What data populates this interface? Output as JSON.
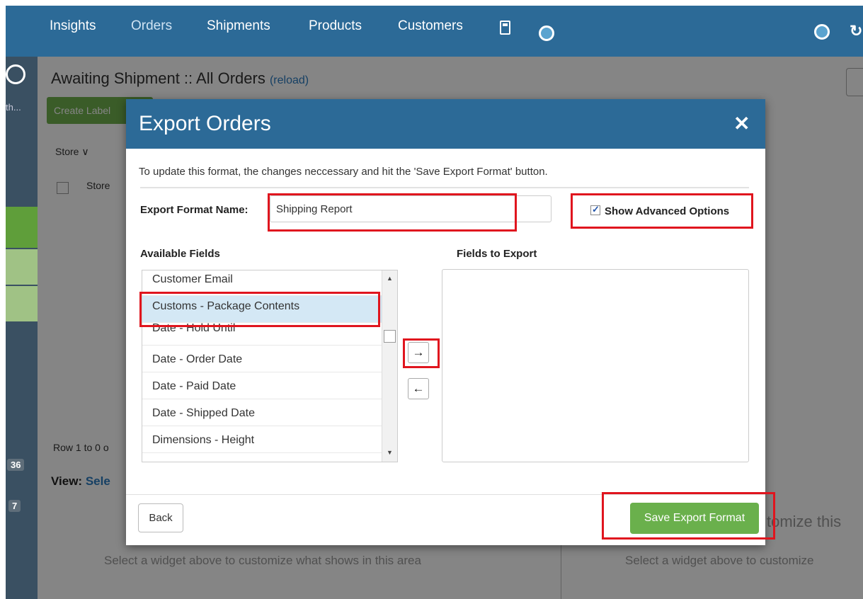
{
  "nav": {
    "items": [
      "Insights",
      "Orders",
      "Shipments",
      "Products",
      "Customers"
    ]
  },
  "page": {
    "title": "Awaiting Shipment :: All Orders",
    "reload": "(reload)",
    "create_label": "Create Label",
    "store_filter": "Store ∨",
    "store_col": "Store",
    "row_info": "Row 1 to 0 o",
    "view_label": "View:",
    "view_select": "Sele",
    "widget_hint_left": "Select a widget above to customize what shows in this area",
    "widget_hint_right": "Select a widget above to customize",
    "customize_text": "tomize this",
    "search_hint": "th...",
    "badge_1": "36",
    "badge_2": "7"
  },
  "modal": {
    "title": "Export Orders",
    "close": "✕",
    "description": "To update this format, the changes neccessary and hit the 'Save Export Format' button.",
    "format_name_label": "Export Format Name:",
    "format_name_value": "Shipping Report",
    "show_advanced_label": "Show Advanced Options",
    "show_advanced_checked": true,
    "available_fields_label": "Available Fields",
    "fields_to_export_label": "Fields to Export",
    "available_fields": [
      "Customer Email",
      "Customs - Package Contents",
      "Date - Hold Until",
      "Date - Order Date",
      "Date - Paid Date",
      "Date - Shipped Date",
      "Dimensions - Height"
    ],
    "selected_field": "Customs - Package Contents",
    "fields_to_export": [],
    "back_label": "Back",
    "save_label": "Save Export Format"
  },
  "colors": {
    "header_blue": "#2c6a97",
    "save_green": "#6ab04c",
    "highlight_red": "#e0151e",
    "selected_row": "#d4e8f5"
  }
}
